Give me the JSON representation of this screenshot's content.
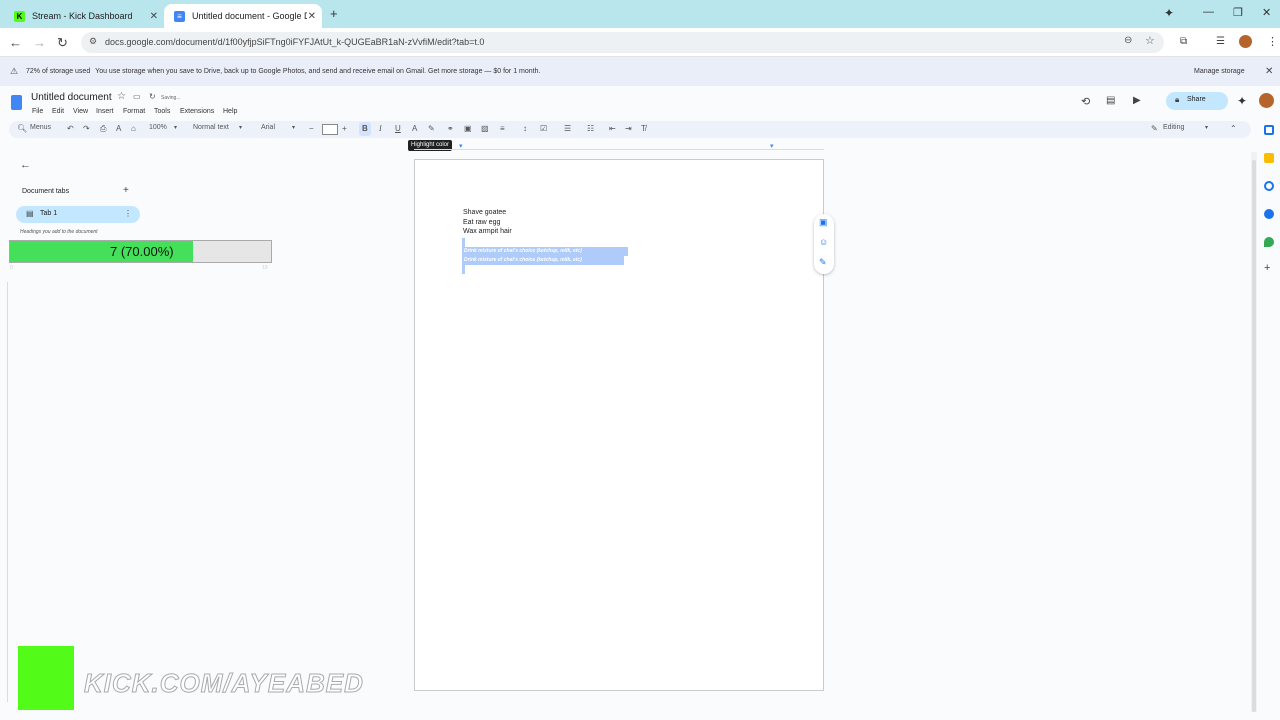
{
  "browser": {
    "tabs": [
      {
        "title": "Stream - Kick Dashboard",
        "active": false
      },
      {
        "title": "Untitled document - Google Do",
        "active": true
      }
    ],
    "url": "docs.google.com/document/d/1f00yfjpSiFTng0iFYFJAtUt_k-QUGEaBR1aN-zVvfiM/edit?tab=t.0"
  },
  "banner": {
    "bold": "72% of storage used",
    "message": "You use storage when you save to Drive, back up to Google Photos, and send and receive email on Gmail. Get more storage — $0 for 1 month.",
    "manage": "Manage storage"
  },
  "doc": {
    "title": "Untitled document",
    "status": "Saving...",
    "menus": [
      "File",
      "Edit",
      "View",
      "Insert",
      "Format",
      "Tools",
      "Extensions",
      "Help"
    ],
    "share": "Share"
  },
  "toolbar": {
    "menus_label": "Menus",
    "zoom": "100%",
    "style": "Normal text",
    "font": "Arial",
    "mode": "Editing",
    "tooltip": "Highlight color"
  },
  "sidebar": {
    "title": "Document tabs",
    "tab_label": "Tab 1",
    "hint": "Headings you add to the document"
  },
  "page": {
    "lines": [
      "Shave goatee",
      "Eat raw egg",
      "Wax armpit hair"
    ],
    "selected": [
      "Drink mixture of chat's choice (ketchup, milk, etc)",
      "Drink mixture of chat's choice (ketchup, milk, etc)"
    ]
  },
  "overlay": {
    "progress_label": "7 (70.00%)",
    "progress_value": 0.7,
    "progress_min": "0",
    "progress_max": "10",
    "watermark": "KICK.COM/AYEABED"
  },
  "colors": {
    "kick_green": "#53fc18",
    "progress_green": "#45e05a",
    "docs_blue": "#4285f4",
    "selection": "#aecbfa"
  }
}
